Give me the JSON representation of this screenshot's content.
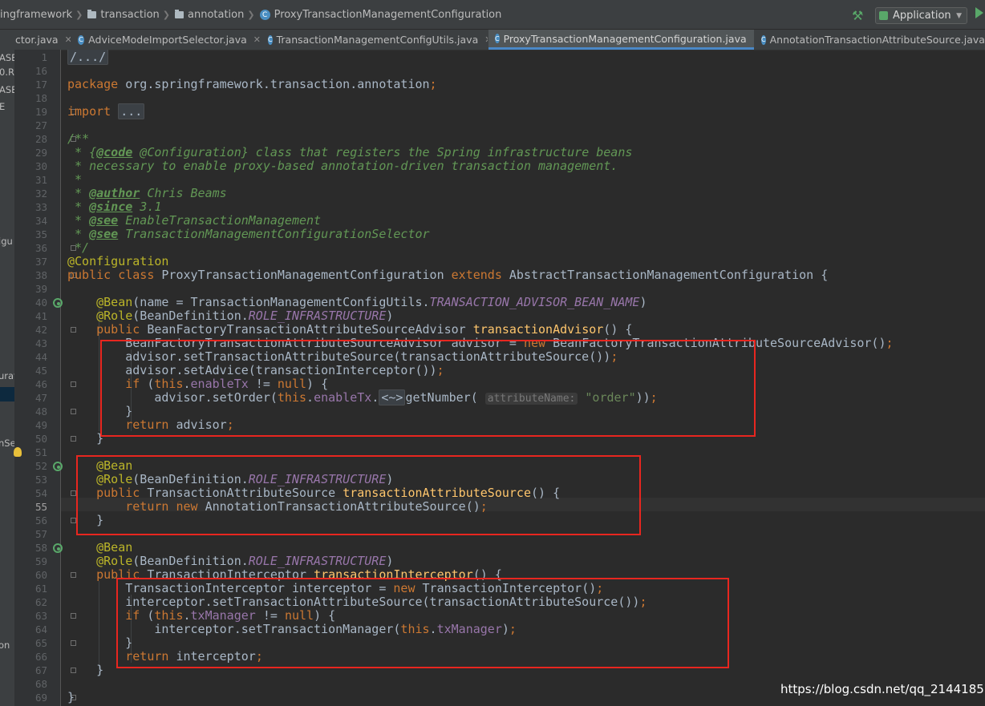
{
  "breadcrumb": [
    "ingframework",
    "transaction",
    "annotation",
    "ProxyTransactionManagementConfiguration"
  ],
  "run_config": {
    "label": "Application"
  },
  "tabs": [
    {
      "label": "ctor.java"
    },
    {
      "label": "AdviceModeImportSelector.java"
    },
    {
      "label": "TransactionManagementConfigUtils.java"
    },
    {
      "label": "ProxyTransactionManagementConfiguration.java"
    },
    {
      "label": "AnnotationTransactionAttributeSource.java"
    }
  ],
  "left_panel_fragments": [
    "ASE",
    "0.R",
    "ASE",
    "E",
    "igu",
    "urat",
    "nSe",
    "on"
  ],
  "editor": {
    "line_numbers": [
      "1",
      "16",
      "17",
      "18",
      "19",
      "27",
      "28",
      "29",
      "30",
      "31",
      "32",
      "33",
      "34",
      "35",
      "36",
      "37",
      "38",
      "39",
      "40",
      "41",
      "42",
      "43",
      "44",
      "45",
      "46",
      "47",
      "48",
      "49",
      "50",
      "51",
      "52",
      "53",
      "54",
      "55",
      "56",
      "57",
      "58",
      "59",
      "60",
      "61",
      "62",
      "63",
      "64",
      "65",
      "66",
      "67",
      "68",
      "69"
    ],
    "current_line": "55",
    "lines": [
      [
        {
          "t": "/.../",
          "c": "fldmark"
        }
      ],
      [],
      [
        {
          "t": "package ",
          "c": "kw"
        },
        {
          "t": "org.springframework.transaction.annotation"
        },
        {
          "t": ";",
          "c": "kw"
        }
      ],
      [],
      [
        {
          "t": "import ",
          "c": "kw"
        },
        {
          "t": "...",
          "c": "fldmark"
        }
      ],
      [],
      [
        {
          "t": "/**",
          "c": "cm"
        }
      ],
      [
        {
          "t": " * ",
          "c": "cm"
        },
        {
          "t": "{",
          "c": "cm"
        },
        {
          "t": "@code",
          "c": "tag"
        },
        {
          "t": " @Configuration} class that registers the Spring infrastructure beans",
          "c": "cm"
        }
      ],
      [
        {
          "t": " * necessary to enable proxy-based annotation-driven transaction management.",
          "c": "cm"
        }
      ],
      [
        {
          "t": " *",
          "c": "cm"
        }
      ],
      [
        {
          "t": " * ",
          "c": "cm"
        },
        {
          "t": "@author",
          "c": "tag"
        },
        {
          "t": " Chris Beams",
          "c": "cm"
        }
      ],
      [
        {
          "t": " * ",
          "c": "cm"
        },
        {
          "t": "@since",
          "c": "tag"
        },
        {
          "t": " 3.1",
          "c": "cm"
        }
      ],
      [
        {
          "t": " * ",
          "c": "cm"
        },
        {
          "t": "@see",
          "c": "tag"
        },
        {
          "t": " EnableTransactionManagement",
          "c": "cm"
        }
      ],
      [
        {
          "t": " * ",
          "c": "cm"
        },
        {
          "t": "@see",
          "c": "tag"
        },
        {
          "t": " TransactionManagementConfigurationSelector",
          "c": "cm"
        }
      ],
      [
        {
          "t": " */",
          "c": "cm"
        }
      ],
      [
        {
          "t": "@Configuration",
          "c": "ann"
        }
      ],
      [
        {
          "t": "public class ",
          "c": "kw"
        },
        {
          "t": "ProxyTransactionManagementConfiguration "
        },
        {
          "t": "extends ",
          "c": "kw"
        },
        {
          "t": "AbstractTransactionManagementConfiguration {"
        }
      ],
      [],
      [
        {
          "t": "    "
        },
        {
          "t": "@Bean",
          "c": "ann"
        },
        {
          "t": "(name = TransactionManagementConfigUtils."
        },
        {
          "t": "TRANSACTION_ADVISOR_BEAN_NAME",
          "c": "cst"
        },
        {
          "t": ")"
        }
      ],
      [
        {
          "t": "    "
        },
        {
          "t": "@Role",
          "c": "ann"
        },
        {
          "t": "(BeanDefinition."
        },
        {
          "t": "ROLE_INFRASTRUCTURE",
          "c": "cst"
        },
        {
          "t": ")"
        }
      ],
      [
        {
          "t": "    "
        },
        {
          "t": "public ",
          "c": "kw"
        },
        {
          "t": "BeanFactoryTransactionAttributeSourceAdvisor "
        },
        {
          "t": "transactionAdvisor",
          "c": "mth"
        },
        {
          "t": "() {"
        }
      ],
      [
        {
          "t": "        BeanFactoryTransactionAttributeSourceAdvisor advisor = "
        },
        {
          "t": "new ",
          "c": "kw"
        },
        {
          "t": "BeanFactoryTransactionAttributeSourceAdvisor()"
        },
        {
          "t": ";",
          "c": "kw"
        }
      ],
      [
        {
          "t": "        advisor.setTransactionAttributeSource(transactionAttributeSource())"
        },
        {
          "t": ";",
          "c": "kw"
        }
      ],
      [
        {
          "t": "        advisor.setAdvice(transactionInterceptor())"
        },
        {
          "t": ";",
          "c": "kw"
        }
      ],
      [
        {
          "t": "        "
        },
        {
          "t": "if ",
          "c": "kw"
        },
        {
          "t": "("
        },
        {
          "t": "this",
          "c": "kw"
        },
        {
          "t": "."
        },
        {
          "t": "enableTx",
          "c": "fld"
        },
        {
          "t": " != "
        },
        {
          "t": "null",
          "c": "kw"
        },
        {
          "t": ") {"
        }
      ],
      [
        {
          "t": "            advisor.setOrder("
        },
        {
          "t": "this",
          "c": "kw"
        },
        {
          "t": "."
        },
        {
          "t": "enableTx",
          "c": "fld"
        },
        {
          "t": "."
        },
        {
          "t": "<~>",
          "c": "fldmark"
        },
        {
          "t": "getNumber( "
        },
        {
          "t": "attributeName:",
          "c": "hint"
        },
        {
          "t": " "
        },
        {
          "t": "\"order\"",
          "c": "str"
        },
        {
          "t": "))"
        },
        {
          "t": ";",
          "c": "kw"
        }
      ],
      [
        {
          "t": "        }"
        }
      ],
      [
        {
          "t": "        "
        },
        {
          "t": "return ",
          "c": "kw"
        },
        {
          "t": "advisor"
        },
        {
          "t": ";",
          "c": "kw"
        }
      ],
      [
        {
          "t": "    }"
        }
      ],
      [],
      [
        {
          "t": "    "
        },
        {
          "t": "@Bean",
          "c": "ann"
        }
      ],
      [
        {
          "t": "    "
        },
        {
          "t": "@Role",
          "c": "ann"
        },
        {
          "t": "(BeanDefinition."
        },
        {
          "t": "ROLE_INFRASTRUCTURE",
          "c": "cst"
        },
        {
          "t": ")"
        }
      ],
      [
        {
          "t": "    "
        },
        {
          "t": "public ",
          "c": "kw"
        },
        {
          "t": "TransactionAttributeSource "
        },
        {
          "t": "transactionAttributeSource",
          "c": "mth"
        },
        {
          "t": "() {"
        }
      ],
      [
        {
          "t": "        "
        },
        {
          "t": "return new ",
          "c": "kw"
        },
        {
          "t": "AnnotationTransactionAttributeSource()"
        },
        {
          "t": ";",
          "c": "kw"
        }
      ],
      [
        {
          "t": "    }"
        }
      ],
      [],
      [
        {
          "t": "    "
        },
        {
          "t": "@Bean",
          "c": "ann"
        }
      ],
      [
        {
          "t": "    "
        },
        {
          "t": "@Role",
          "c": "ann"
        },
        {
          "t": "(BeanDefinition."
        },
        {
          "t": "ROLE_INFRASTRUCTURE",
          "c": "cst"
        },
        {
          "t": ")"
        }
      ],
      [
        {
          "t": "    "
        },
        {
          "t": "public ",
          "c": "kw"
        },
        {
          "t": "TransactionInterceptor "
        },
        {
          "t": "transactionInterceptor",
          "c": "mth"
        },
        {
          "t": "() {"
        }
      ],
      [
        {
          "t": "        TransactionInterceptor interceptor = "
        },
        {
          "t": "new ",
          "c": "kw"
        },
        {
          "t": "TransactionInterceptor()"
        },
        {
          "t": ";",
          "c": "kw"
        }
      ],
      [
        {
          "t": "        interceptor.setTransactionAttributeSource(transactionAttributeSource())"
        },
        {
          "t": ";",
          "c": "kw"
        }
      ],
      [
        {
          "t": "        "
        },
        {
          "t": "if ",
          "c": "kw"
        },
        {
          "t": "("
        },
        {
          "t": "this",
          "c": "kw"
        },
        {
          "t": "."
        },
        {
          "t": "txManager",
          "c": "fld"
        },
        {
          "t": " != "
        },
        {
          "t": "null",
          "c": "kw"
        },
        {
          "t": ") {"
        }
      ],
      [
        {
          "t": "            interceptor.setTransactionManager("
        },
        {
          "t": "this",
          "c": "kw"
        },
        {
          "t": "."
        },
        {
          "t": "txManager",
          "c": "fld"
        },
        {
          "t": ")"
        },
        {
          "t": ";",
          "c": "kw"
        }
      ],
      [
        {
          "t": "        }"
        }
      ],
      [
        {
          "t": "        "
        },
        {
          "t": "return ",
          "c": "kw"
        },
        {
          "t": "interceptor"
        },
        {
          "t": ";",
          "c": "kw"
        }
      ],
      [
        {
          "t": "    }"
        }
      ],
      [],
      [
        {
          "t": "}"
        }
      ]
    ]
  },
  "watermark": "https://blog.csdn.net/qq_21441857"
}
